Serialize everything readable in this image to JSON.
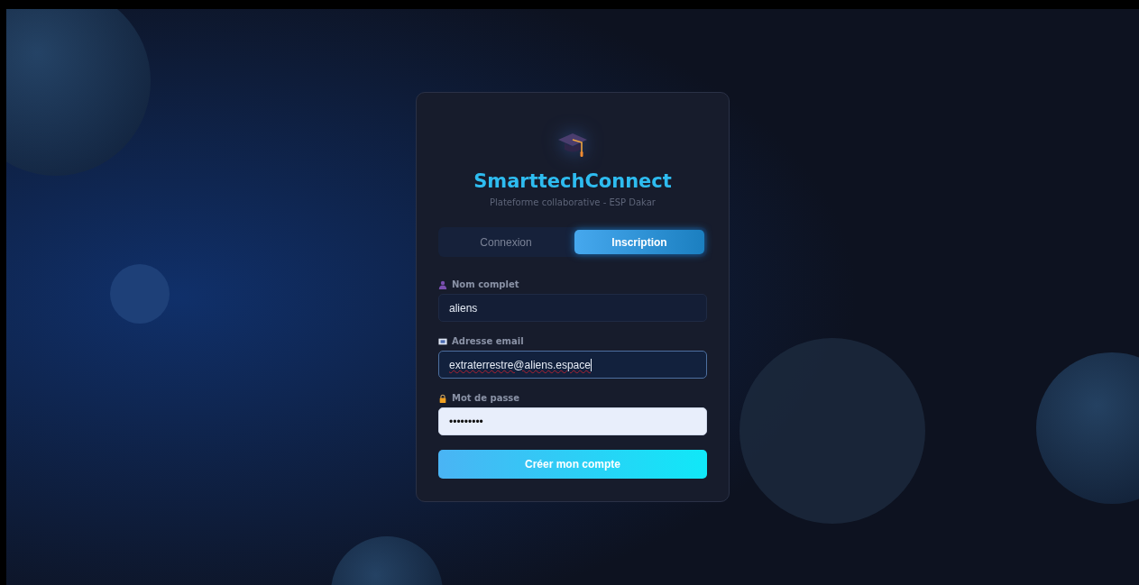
{
  "brand": {
    "title": "SmarttechConnect",
    "subtitle": "Plateforme collaborative - ESP Dakar"
  },
  "tabs": [
    {
      "label": "Connexion",
      "selected": false
    },
    {
      "label": "Inscription",
      "selected": true
    }
  ],
  "fields": [
    {
      "kind": "person",
      "label": "Nom complet",
      "value": "aliens",
      "focused": false,
      "autofilled": false
    },
    {
      "kind": "email",
      "label": "Adresse email",
      "value": "extraterrestre@aliens.espace",
      "focused": true,
      "autofilled": false
    },
    {
      "kind": "password",
      "label": "Mot de passe",
      "value": "•••••••••",
      "focused": false,
      "autofilled": true
    }
  ],
  "submit": {
    "label": "Créer mon compte"
  }
}
